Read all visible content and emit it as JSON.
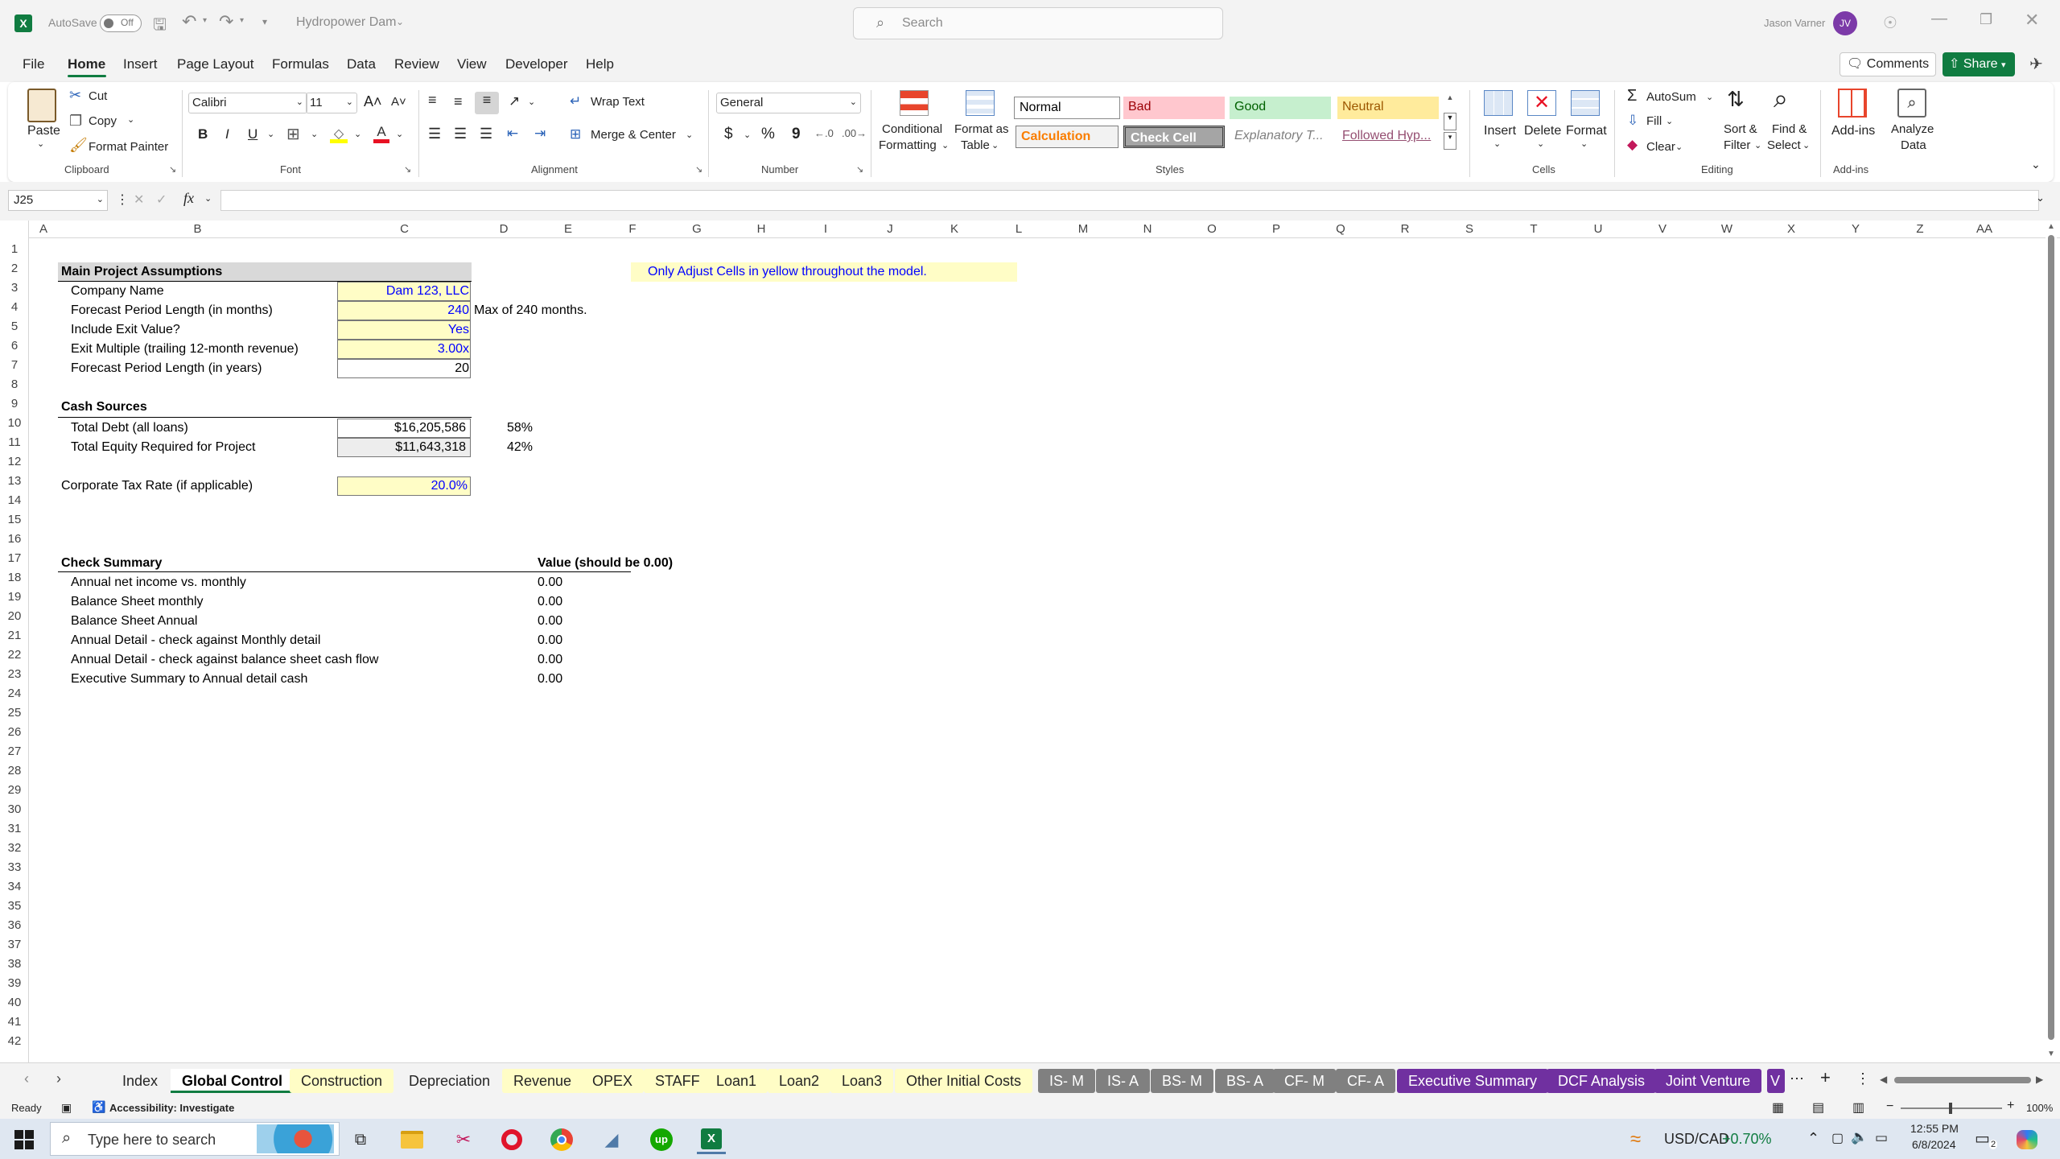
{
  "app": {
    "autosave_label": "AutoSave",
    "autosave_state": "Off",
    "file_name": "Hydropower Dam",
    "search_placeholder": "Search",
    "user_name": "Jason Varner",
    "user_initials": "JV"
  },
  "menu": {
    "items": [
      "File",
      "Home",
      "Insert",
      "Page Layout",
      "Formulas",
      "Data",
      "Review",
      "View",
      "Developer",
      "Help"
    ],
    "active": "Home",
    "comments": "Comments",
    "share": "Share"
  },
  "ribbon": {
    "clipboard": {
      "paste": "Paste",
      "cut": "Cut",
      "copy": "Copy",
      "format_painter": "Format Painter",
      "group": "Clipboard"
    },
    "font": {
      "name": "Calibri",
      "size": "11",
      "group": "Font",
      "bold": "B",
      "italic": "I",
      "underline": "U"
    },
    "alignment": {
      "wrap": "Wrap Text",
      "merge": "Merge & Center",
      "group": "Alignment"
    },
    "number": {
      "format": "General",
      "group": "Number",
      "currency": "$",
      "percent": "%",
      "comma": "9"
    },
    "styles": {
      "cond_line1": "Conditional",
      "cond_line2": "Formatting",
      "fat_line1": "Format as",
      "fat_line2": "Table",
      "normal": "Normal",
      "bad": "Bad",
      "good": "Good",
      "neutral": "Neutral",
      "calculation": "Calculation",
      "check_cell": "Check Cell",
      "explanatory": "Explanatory T...",
      "followed": "Followed Hyp...",
      "group": "Styles"
    },
    "cells": {
      "insert": "Insert",
      "delete": "Delete",
      "format": "Format",
      "group": "Cells"
    },
    "editing": {
      "autosum": "AutoSum",
      "fill": "Fill",
      "clear": "Clear",
      "sort_l1": "Sort &",
      "sort_l2": "Filter",
      "find_l1": "Find &",
      "find_l2": "Select",
      "group": "Editing"
    },
    "addins": {
      "addins": "Add-ins",
      "analyze_l1": "Analyze",
      "analyze_l2": "Data",
      "group": "Add-ins"
    }
  },
  "formula_bar": {
    "name_box": "J25",
    "fx": "fx",
    "formula": ""
  },
  "columns": [
    "A",
    "B",
    "C",
    "D",
    "E",
    "F",
    "G",
    "H",
    "I",
    "J",
    "K",
    "L",
    "M",
    "N",
    "O",
    "P",
    "Q",
    "R",
    "S",
    "T",
    "U",
    "V",
    "W",
    "X",
    "Y",
    "Z",
    "AA"
  ],
  "rows": [
    "1",
    "2",
    "3",
    "4",
    "5",
    "6",
    "7",
    "8",
    "9",
    "10",
    "11",
    "12",
    "13",
    "14",
    "15",
    "16",
    "17",
    "18",
    "19",
    "20",
    "21",
    "22",
    "23",
    "24",
    "25",
    "26",
    "27",
    "28",
    "29",
    "30",
    "31",
    "32",
    "33",
    "34",
    "35",
    "36",
    "37",
    "38",
    "39",
    "40",
    "41",
    "42"
  ],
  "sheet": {
    "main_header": "Main Project Assumptions",
    "company_label": "Company Name",
    "company_value": "Dam 123, LLC",
    "forecast_months_label": "Forecast Period Length (in months)",
    "forecast_months_value": "240",
    "forecast_months_note": "Max of 240 months.",
    "exit_label": "Include Exit Value?",
    "exit_value": "Yes",
    "multiple_label": "Exit Multiple (trailing 12-month revenue)",
    "multiple_value": "3.00x",
    "forecast_years_label": "Forecast Period Length (in years)",
    "forecast_years_value": "20",
    "note": "Only Adjust Cells in yellow throughout the model.",
    "cash_header": "Cash Sources",
    "debt_label": "Total Debt (all loans)",
    "debt_value": "$16,205,586",
    "debt_pct": "58%",
    "equity_label": "Total Equity Required for Project",
    "equity_value": "$11,643,318",
    "equity_pct": "42%",
    "tax_label": "Corporate Tax Rate (if applicable)",
    "tax_value": "20.0%",
    "check_header": "Check Summary",
    "check_value_header": "Value (should be 0.00)",
    "checks": [
      {
        "label": "Annual net income vs. monthly",
        "value": "0.00"
      },
      {
        "label": "Balance Sheet monthly",
        "value": "0.00"
      },
      {
        "label": "Balance Sheet Annual",
        "value": "0.00"
      },
      {
        "label": "Annual Detail - check against Monthly detail",
        "value": "0.00"
      },
      {
        "label": "Annual Detail - check against balance sheet cash flow",
        "value": "0.00"
      },
      {
        "label": "Executive Summary to Annual detail cash",
        "value": "0.00"
      }
    ]
  },
  "tabs": [
    "Index",
    "Global Control",
    "Construction",
    "Depreciation",
    "Revenue",
    "OPEX",
    "STAFF",
    "Loan1",
    "Loan2",
    "Loan3",
    "Other Initial Costs",
    "IS- M",
    "IS- A",
    "BS- M",
    "BS- A",
    "CF- M",
    "CF- A",
    "Executive Summary",
    "DCF Analysis",
    "Joint Venture",
    "V"
  ],
  "status": {
    "ready": "Ready",
    "accessibility": "Accessibility: Investigate",
    "zoom": "100%"
  },
  "taskbar": {
    "search_placeholder": "Type here to search",
    "ticker": "USD/CAD",
    "change": "+0.70%",
    "time": "12:55 PM",
    "date": "6/8/2024",
    "notif": "2"
  },
  "colors": {
    "yellow": "#fffdc6",
    "input_blue": "#0000ff",
    "excel_green": "#107c41",
    "purple": "#7030a0",
    "grey_tab": "#808080"
  }
}
